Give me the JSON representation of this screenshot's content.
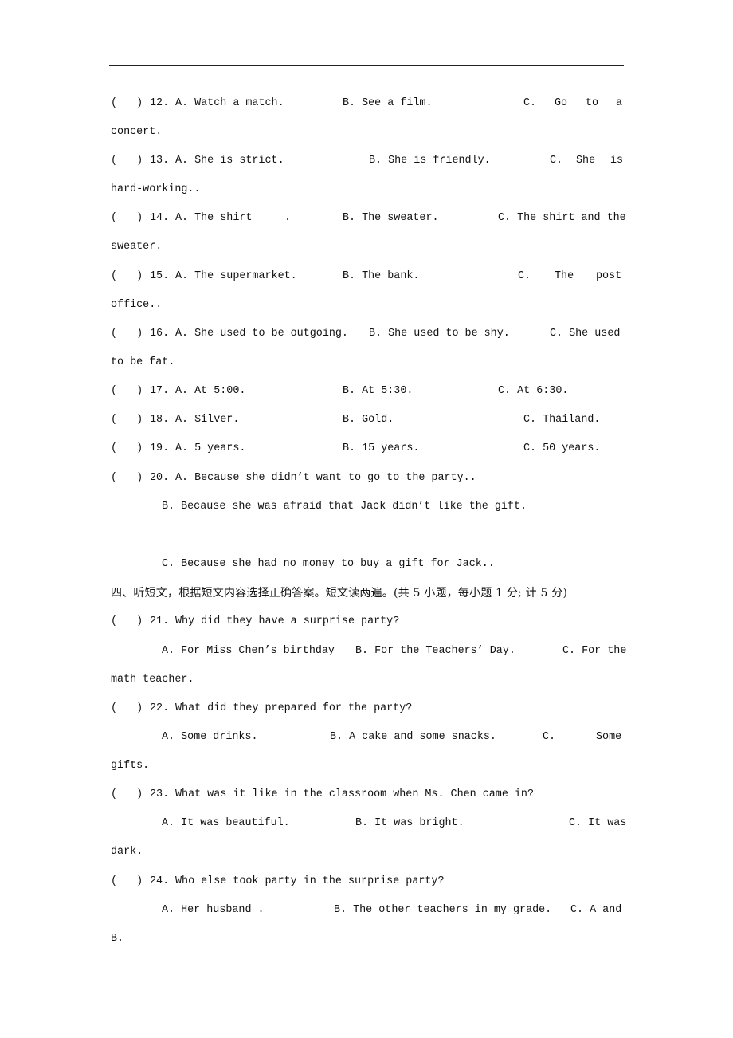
{
  "paren": "(   )",
  "q12": {
    "num": "12.",
    "a": "A. Watch a match.",
    "b": "B. See a film.",
    "c": [
      "C.",
      "Go",
      "to",
      "a"
    ],
    "cont": "concert."
  },
  "q13": {
    "num": "13.",
    "a": "A. She is strict.",
    "b": "B. She is friendly.",
    "c": [
      "C.",
      "She",
      "is"
    ],
    "cont": "hard-working.."
  },
  "q14": {
    "num": "14.",
    "a": "A. The shirt",
    "a_dot": ".",
    "b": "B. The sweater.",
    "c": "C. The shirt and the",
    "cont": "sweater."
  },
  "q15": {
    "num": "15.",
    "a": "A. The supermarket.",
    "b": "B. The bank.",
    "c": [
      "C.",
      "The",
      "post"
    ],
    "cont": "office.."
  },
  "q16": {
    "num": "16.",
    "a": "A. She used to be outgoing.",
    "b": "B. She used to be shy.",
    "c": "C. She used",
    "cont": "to be fat."
  },
  "q17": {
    "num": "17.",
    "a": "A. At 5:00.",
    "b": "B. At 5:30.",
    "c": "C. At 6:30."
  },
  "q18": {
    "num": "18.",
    "a": "A. Silver.",
    "b": "B. Gold.",
    "c": "C. Thailand."
  },
  "q19": {
    "num": "19.",
    "a": "A. 5 years.",
    "b": "B. 15 years.",
    "c": "C. 50 years."
  },
  "q20": {
    "num": "20.",
    "a": "A. Because she didn’t want to go to the party..",
    "b": "B. Because she was afraid that Jack didn’t like the gift.",
    "c": "C. Because she had no money to buy a gift for Jack.."
  },
  "section4": {
    "heading": "四、听短文，根据短文内容选择正确答案。短文读两遍。(共 5 小题，每小题 1 分; 计 5 分)"
  },
  "q21": {
    "num": "21.",
    "stem": "Why did they have a surprise party?",
    "a": "A. For Miss Chen’s birthday",
    "b": "B. For the Teachers’ Day.",
    "c": "C. For the",
    "cont": "math teacher."
  },
  "q22": {
    "num": "22.",
    "stem": "What did they prepared for the party?",
    "a": "A. Some drinks.",
    "b": "B. A cake and some snacks.",
    "c": [
      "C.",
      "Some"
    ],
    "cont": "gifts."
  },
  "q23": {
    "num": "23.",
    "stem": "What was it like in the classroom when Ms. Chen came in?",
    "a": "A. It was beautiful.",
    "b": "B. It was bright.",
    "c": "C. It was",
    "cont": "dark."
  },
  "q24": {
    "num": "24.",
    "stem": "Who else took party in the surprise party?",
    "a": "A. Her husband .",
    "b": "B. The other teachers in my grade.",
    "c": "C. A and",
    "cont": "B."
  }
}
